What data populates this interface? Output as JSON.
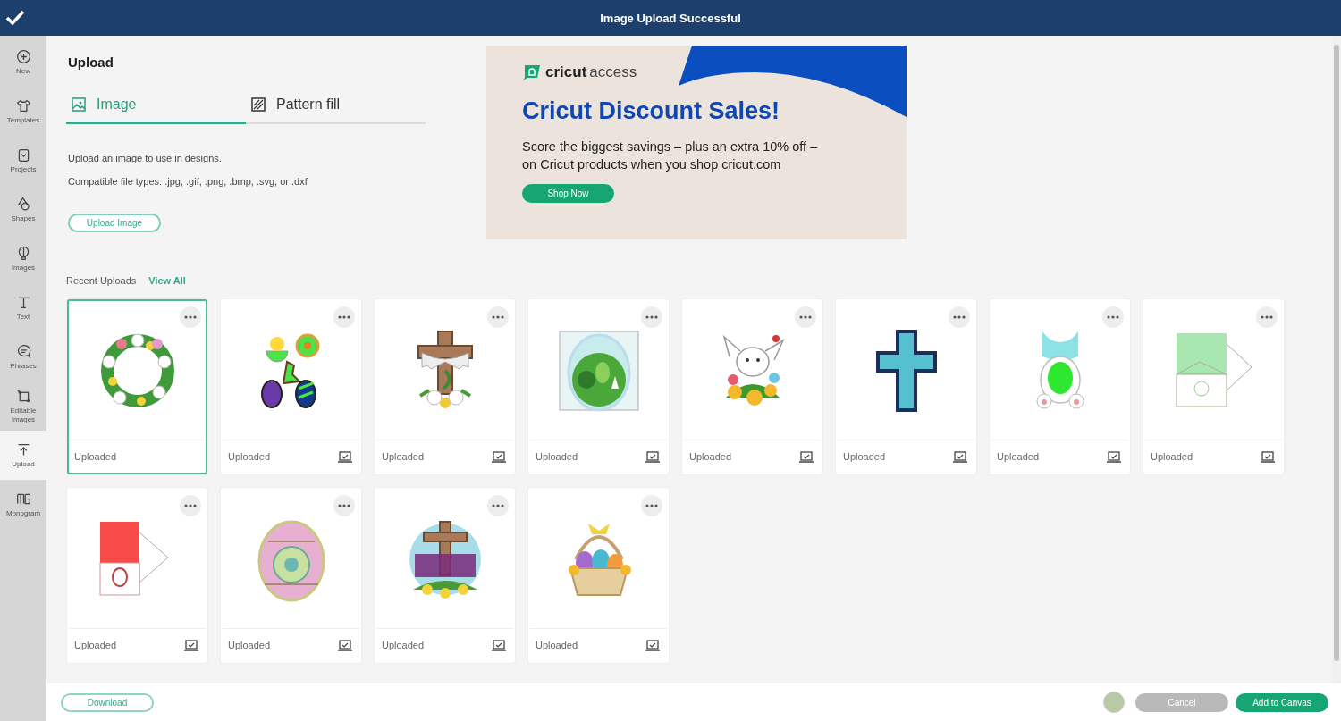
{
  "header": {
    "title": "Image Upload Successful"
  },
  "sidebar": {
    "items": [
      {
        "label": "New",
        "selected": false
      },
      {
        "label": "Templates",
        "selected": false
      },
      {
        "label": "Projects",
        "selected": false
      },
      {
        "label": "Shapes",
        "selected": false
      },
      {
        "label": "Images",
        "selected": false
      },
      {
        "label": "Text",
        "selected": false
      },
      {
        "label": "Phrases",
        "selected": false
      },
      {
        "label": "Editable Images",
        "selected": false
      },
      {
        "label": "Upload",
        "selected": true
      },
      {
        "label": "Monogram",
        "selected": false
      }
    ]
  },
  "panel": {
    "title": "Upload",
    "tabs": [
      {
        "label": "Image",
        "selected": true
      },
      {
        "label": "Pattern fill",
        "selected": false
      }
    ],
    "description": "Upload an image to use in designs.",
    "file_types": "Compatible file types: .jpg, .gif, .png, .bmp, .svg, or .dxf",
    "upload_button": "Upload Image"
  },
  "ad": {
    "logo": "cricut",
    "logo_suffix": "access",
    "headline": "Cricut Discount Sales!",
    "body_lines": [
      "Score the biggest savings – plus an extra 10% off –",
      "on Cricut products when you shop cricut.com"
    ],
    "button": "Shop Now"
  },
  "recent": {
    "title": "Recent Uploads",
    "view_all": "View All",
    "items": [
      {
        "status": "Uploaded",
        "selected": true
      },
      {
        "status": "Uploaded",
        "selected": false
      },
      {
        "status": "Uploaded",
        "selected": false
      },
      {
        "status": "Uploaded",
        "selected": false
      },
      {
        "status": "Uploaded",
        "selected": false
      },
      {
        "status": "Uploaded",
        "selected": false
      },
      {
        "status": "Uploaded",
        "selected": false
      },
      {
        "status": "Uploaded",
        "selected": false
      },
      {
        "status": "Uploaded",
        "selected": false
      },
      {
        "status": "Uploaded",
        "selected": false
      },
      {
        "status": "Uploaded",
        "selected": false
      },
      {
        "status": "Uploaded",
        "selected": false
      }
    ]
  },
  "footer": {
    "download": "Download",
    "cancel": "Cancel",
    "add": "Add to Canvas"
  }
}
